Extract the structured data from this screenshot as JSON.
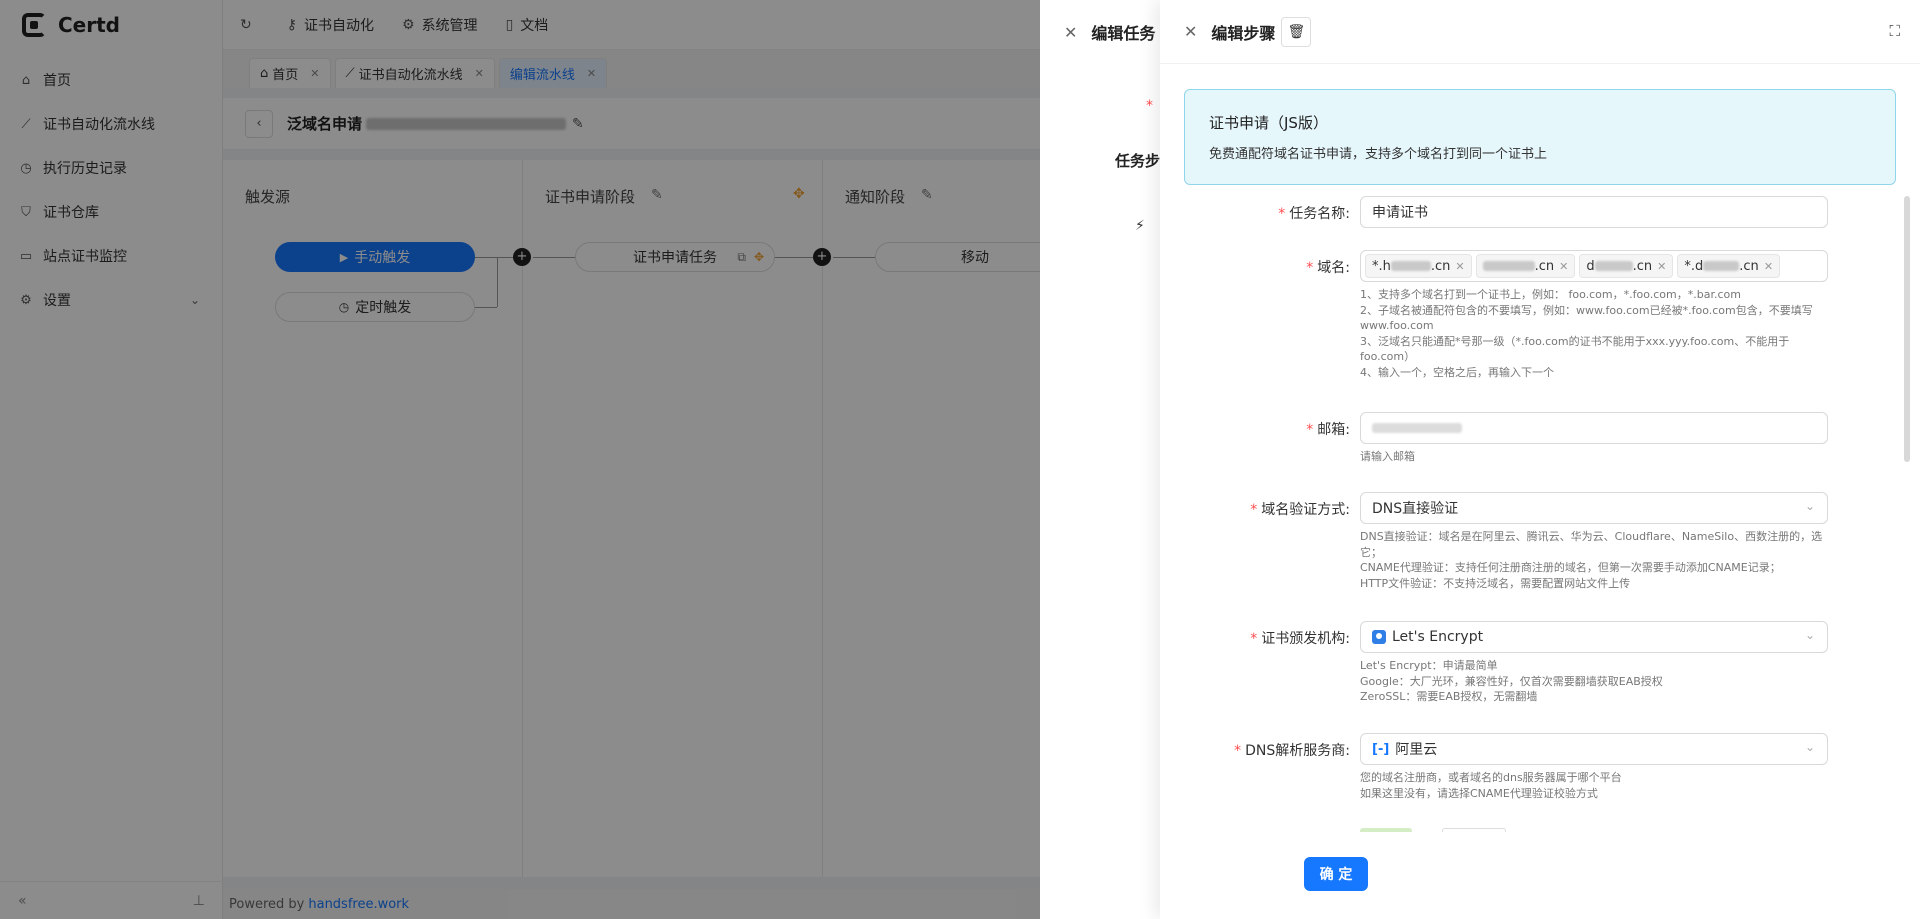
{
  "app": {
    "logo": "Certd"
  },
  "sidebar": {
    "items": [
      {
        "label": "首页",
        "icon": "home-icon"
      },
      {
        "label": "证书自动化流水线",
        "icon": "line-chart-icon"
      },
      {
        "label": "执行历史记录",
        "icon": "history-icon"
      },
      {
        "label": "证书仓库",
        "icon": "shield-icon"
      },
      {
        "label": "站点证书监控",
        "icon": "video-icon"
      },
      {
        "label": "设置",
        "icon": "gear-icon"
      }
    ]
  },
  "topbar": {
    "items": [
      {
        "label": "证书自动化",
        "icon": "key-icon"
      },
      {
        "label": "系统管理",
        "icon": "gear-icon"
      },
      {
        "label": "文档",
        "icon": "book-icon"
      }
    ]
  },
  "tabs": [
    {
      "label": "首页"
    },
    {
      "label": "证书自动化流水线"
    },
    {
      "label": "编辑流水线"
    }
  ],
  "pipeline": {
    "title": "泛域名申请",
    "stages": [
      {
        "title": "触发源"
      },
      {
        "title": "证书申请阶段"
      },
      {
        "title": "通知阶段"
      }
    ],
    "manual_trigger": "手动触发",
    "timer_trigger": "定时触发",
    "cert_task": "证书申请任务",
    "notify_task": "移动"
  },
  "footer": {
    "powered": "Powered by",
    "link": "handsfree.work"
  },
  "drawer1": {
    "title": "编辑任务",
    "peek_label": "任务步"
  },
  "drawer2": {
    "title": "编辑步骤",
    "plugin": {
      "name": "证书申请（JS版）",
      "desc": "免费通配符域名证书申请，支持多个域名打到同一个证书上"
    },
    "fields": {
      "task_name": {
        "label": "任务名称:",
        "value": "申请证书"
      },
      "domains": {
        "label": "域名:",
        "tags": [
          ".cn",
          ".cn",
          ".cn",
          ".cn"
        ],
        "tag_prefixes": [
          "*.h",
          "",
          "d",
          "*.d"
        ],
        "help": [
          "1、支持多个域名打到一个证书上，例如： foo.com，*.foo.com，*.bar.com",
          "2、子域名被通配符包含的不要填写，例如：www.foo.com已经被*.foo.com包含，不要填写www.foo.com",
          "3、泛域名只能通配*号那一级（*.foo.com的证书不能用于xxx.yyy.foo.com、不能用于foo.com）",
          "4、输入一个，空格之后，再输入下一个"
        ]
      },
      "email": {
        "label": "邮箱:",
        "help": "请输入邮箱"
      },
      "challenge": {
        "label": "域名验证方式:",
        "value": "DNS直接验证",
        "help": [
          "DNS直接验证：域名是在阿里云、腾讯云、华为云、Cloudflare、NameSilo、西数注册的，选它；",
          "CNAME代理验证：支持任何注册商注册的域名，但第一次需要手动添加CNAME记录；",
          "HTTP文件验证：不支持泛域名，需要配置网站文件上传"
        ]
      },
      "ca": {
        "label": "证书颁发机构:",
        "value": "Let's Encrypt",
        "help": [
          "Let's Encrypt：申请最简单",
          "Google：大厂光环，兼容性好，仅首次需要翻墙获取EAB授权",
          "ZeroSSL：需要EAB授权，无需翻墙"
        ]
      },
      "dns": {
        "label": "DNS解析服务商:",
        "value": "阿里云",
        "help": [
          "您的域名注册商，或者域名的dns服务器属于哪个平台",
          "如果这里没有，请选择CNAME代理验证校验方式"
        ]
      }
    },
    "confirm": "确 定"
  },
  "colors": {
    "primary": "#1677ff",
    "required": "#ff4d4f",
    "plugin_bg": "#e6f7fc"
  }
}
